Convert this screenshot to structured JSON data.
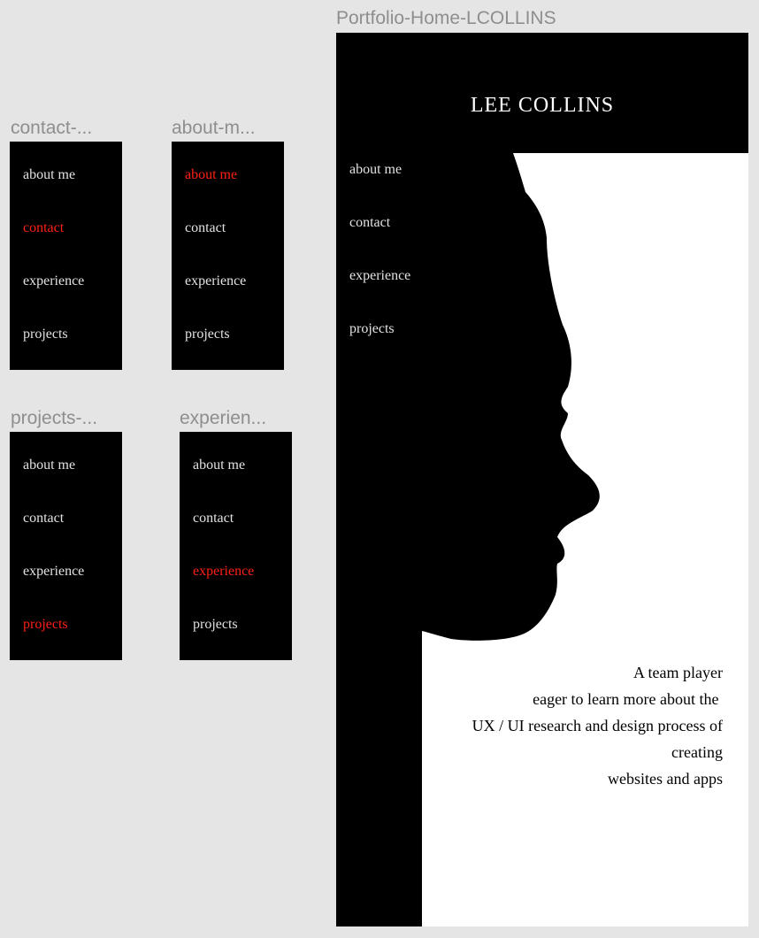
{
  "frames": {
    "contact": {
      "label": "contact-...",
      "items": [
        "about me",
        "contact",
        "experience",
        "projects"
      ],
      "active": 1
    },
    "about": {
      "label": "about-m...",
      "items": [
        "about me",
        "contact",
        "experience",
        "projects"
      ],
      "active": 0
    },
    "projects": {
      "label": "projects-...",
      "items": [
        "about me",
        "contact",
        "experience",
        "projects"
      ],
      "active": 3
    },
    "experience": {
      "label": "experien...",
      "items": [
        "about me",
        "contact",
        "experience",
        "projects"
      ],
      "active": 2
    }
  },
  "home": {
    "label": "Portfolio-Home-LCOLLINS",
    "title": "LEE COLLINS",
    "nav": [
      "about me",
      "contact",
      "experience",
      "projects"
    ],
    "tagline": [
      "A team player",
      "eager to learn more about the ",
      "UX / UI research and design process of",
      "creating",
      "websites and apps"
    ]
  },
  "colors": {
    "canvas": "#e5e5e5",
    "frame_label": "#8e8e8e",
    "menu_bg": "#000000",
    "menu_text": "#e2e2e2",
    "active_text": "#ff2015"
  }
}
